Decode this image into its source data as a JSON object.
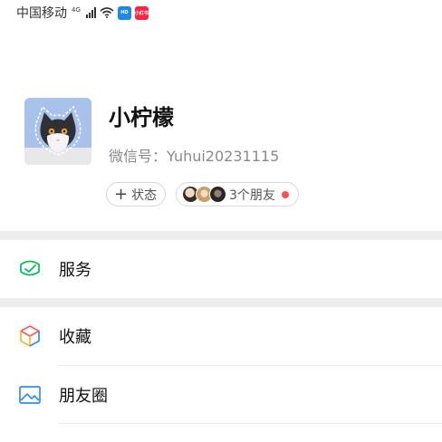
{
  "status_bar": {
    "carrier": "中国移动",
    "network": "4G",
    "badge_1_text": "HD",
    "badge_2_text": "小红书",
    "badge_1_color": "#1e88e5",
    "badge_2_color": "#ff2442"
  },
  "profile": {
    "nickname": "小柠檬",
    "wechat_id": "微信号：Yuhui20231115",
    "status_label": "状态",
    "friends_label": "3个朋友",
    "dot_color": "#fa5151"
  },
  "menu": {
    "services": "服务",
    "favorites": "收藏",
    "moments": "朋友圈"
  },
  "colors": {
    "services_icon": "#07c160",
    "moments_icon": "#2f8ef0"
  },
  "icons": {
    "services": "wallet-check-icon",
    "favorites": "cube-icon",
    "moments": "photo-icon"
  }
}
